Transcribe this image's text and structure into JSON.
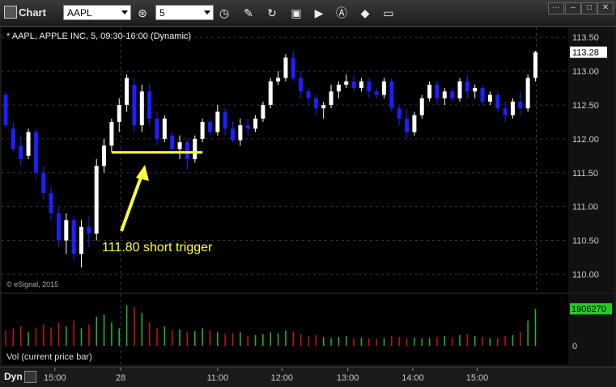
{
  "window": {
    "title": "Chart",
    "symbol": "AAPL",
    "interval": "5"
  },
  "chart_header": "* AAPL, APPLE INC, 5, 09:30-16:00 (Dynamic)",
  "copyright": "© eSignal, 2015",
  "annotation": "111.80 short trigger",
  "volume_label": "Vol (current price bar)",
  "bottom": {
    "mode": "Dyn"
  },
  "colors": {
    "up": "#ffffff",
    "down": "#1e1eff",
    "annotation": "#ffff33",
    "vol_up": "#22bb22",
    "vol_down": "#cc1111",
    "last_price_badge": "#ffffff",
    "vol_badge": "#22cc22"
  },
  "chart_data": [
    {
      "type": "candlestick",
      "title": "AAPL, APPLE INC, 5",
      "y_ticks": [
        "113.50",
        "113.00",
        "112.50",
        "112.00",
        "111.50",
        "111.00",
        "110.50",
        "110.00"
      ],
      "ylim": [
        109.85,
        113.55
      ],
      "last_price": "113.28",
      "x_ticks": [
        "15:00",
        "28",
        "11:00",
        "12:00",
        "13:00",
        "14:00",
        "15:00"
      ],
      "trigger_level": 111.8,
      "ohlc": [
        [
          112.65,
          112.7,
          112.15,
          112.2
        ],
        [
          112.15,
          112.25,
          111.8,
          111.85
        ],
        [
          111.9,
          112.05,
          111.6,
          111.7
        ],
        [
          111.75,
          112.15,
          111.7,
          112.1
        ],
        [
          112.1,
          112.15,
          111.4,
          111.5
        ],
        [
          111.5,
          111.6,
          111.1,
          111.2
        ],
        [
          111.2,
          111.3,
          110.8,
          110.9
        ],
        [
          110.9,
          111.0,
          110.4,
          110.5
        ],
        [
          110.5,
          110.9,
          110.3,
          110.8
        ],
        [
          110.8,
          110.85,
          110.2,
          110.3
        ],
        [
          110.3,
          110.8,
          110.1,
          110.7
        ],
        [
          110.7,
          110.85,
          110.4,
          110.6
        ],
        [
          110.6,
          111.7,
          110.5,
          111.6
        ],
        [
          111.6,
          112.0,
          111.5,
          111.9
        ],
        [
          111.9,
          112.3,
          111.8,
          112.25
        ],
        [
          112.25,
          112.6,
          112.1,
          112.5
        ],
        [
          112.5,
          112.95,
          112.4,
          112.9
        ],
        [
          112.8,
          112.9,
          112.1,
          112.2
        ],
        [
          112.2,
          112.8,
          112.1,
          112.7
        ],
        [
          112.7,
          112.8,
          112.2,
          112.3
        ],
        [
          112.3,
          112.4,
          111.9,
          112.0
        ],
        [
          112.0,
          112.35,
          111.95,
          112.3
        ],
        [
          112.05,
          112.1,
          111.75,
          111.85
        ],
        [
          111.85,
          112.05,
          111.7,
          111.95
        ],
        [
          111.95,
          112.0,
          111.55,
          111.7
        ],
        [
          111.7,
          112.05,
          111.65,
          112.0
        ],
        [
          112.0,
          112.3,
          111.95,
          112.25
        ],
        [
          112.25,
          112.3,
          112.05,
          112.1
        ],
        [
          112.1,
          112.5,
          112.05,
          112.4
        ],
        [
          112.4,
          112.45,
          112.05,
          112.15
        ],
        [
          112.15,
          112.25,
          111.95,
          111.98
        ],
        [
          111.98,
          112.3,
          111.9,
          112.2
        ],
        [
          112.2,
          112.3,
          112.05,
          112.15
        ],
        [
          112.15,
          112.35,
          112.1,
          112.3
        ],
        [
          112.3,
          112.55,
          112.25,
          112.5
        ],
        [
          112.5,
          112.9,
          112.45,
          112.85
        ],
        [
          112.85,
          113.0,
          112.8,
          112.9
        ],
        [
          112.9,
          113.25,
          112.85,
          113.2
        ],
        [
          113.2,
          113.3,
          112.85,
          112.9
        ],
        [
          112.9,
          113.0,
          112.6,
          112.7
        ],
        [
          112.7,
          112.75,
          112.5,
          112.6
        ],
        [
          112.6,
          112.65,
          112.35,
          112.45
        ],
        [
          112.45,
          112.55,
          112.3,
          112.5
        ],
        [
          112.5,
          112.8,
          112.45,
          112.7
        ],
        [
          112.7,
          112.85,
          112.6,
          112.8
        ],
        [
          112.8,
          112.95,
          112.75,
          112.85
        ],
        [
          112.85,
          112.95,
          112.7,
          112.75
        ],
        [
          112.75,
          112.9,
          112.7,
          112.85
        ],
        [
          112.85,
          112.9,
          112.6,
          112.7
        ],
        [
          112.7,
          112.75,
          112.6,
          112.65
        ],
        [
          112.65,
          112.9,
          112.6,
          112.85
        ],
        [
          112.85,
          112.9,
          112.4,
          112.45
        ],
        [
          112.45,
          112.5,
          112.2,
          112.3
        ],
        [
          112.3,
          112.45,
          112.0,
          112.1
        ],
        [
          112.1,
          112.4,
          112.05,
          112.35
        ],
        [
          112.35,
          112.65,
          112.3,
          112.6
        ],
        [
          112.6,
          112.85,
          112.55,
          112.8
        ],
        [
          112.8,
          112.85,
          112.5,
          112.6
        ],
        [
          112.6,
          112.75,
          112.5,
          112.7
        ],
        [
          112.7,
          112.75,
          112.55,
          112.6
        ],
        [
          112.6,
          112.9,
          112.55,
          112.85
        ],
        [
          112.85,
          112.95,
          112.6,
          112.7
        ],
        [
          112.7,
          112.8,
          112.6,
          112.75
        ],
        [
          112.75,
          112.8,
          112.5,
          112.55
        ],
        [
          112.55,
          112.7,
          112.5,
          112.65
        ],
        [
          112.65,
          112.7,
          112.4,
          112.45
        ],
        [
          112.45,
          112.55,
          112.25,
          112.35
        ],
        [
          112.35,
          112.6,
          112.3,
          112.55
        ],
        [
          112.55,
          112.7,
          112.35,
          112.45
        ],
        [
          112.45,
          112.95,
          112.4,
          112.9
        ],
        [
          112.9,
          113.3,
          112.85,
          113.28
        ]
      ],
      "volume_ylim": [
        0,
        2500000
      ],
      "volume_ticks": [
        "0"
      ],
      "last_volume": "1906270",
      "volumes": [
        800000,
        900000,
        1000000,
        700000,
        900000,
        1100000,
        950000,
        1200000,
        1000000,
        1300000,
        900000,
        1100000,
        1500000,
        1600000,
        1200000,
        900000,
        2100000,
        2000000,
        1700000,
        1200000,
        900000,
        1000000,
        800000,
        850000,
        700000,
        750000,
        900000,
        800000,
        700000,
        600000,
        650000,
        700000,
        500000,
        550000,
        600000,
        700000,
        650000,
        800000,
        750000,
        600000,
        500000,
        550000,
        450000,
        400000,
        450000,
        500000,
        400000,
        420000,
        380000,
        350000,
        400000,
        500000,
        450000,
        400000,
        420000,
        380000,
        400000,
        450000,
        500000,
        420000,
        560000,
        600000,
        500000,
        450000,
        400000,
        420000,
        500000,
        550000,
        700000,
        1300000,
        1906270
      ]
    }
  ]
}
